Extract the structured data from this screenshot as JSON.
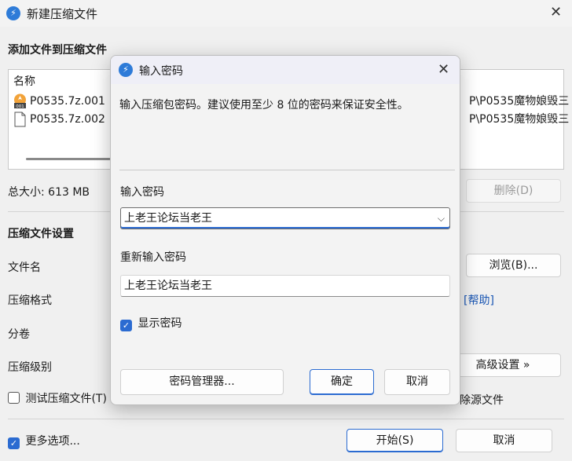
{
  "bg": {
    "title": "新建压缩文件",
    "add_heading": "添加文件到压缩文件",
    "list_header": "名称",
    "files": [
      {
        "name": "P0535.7z.001",
        "path": "P\\P0535魔物娘毁三"
      },
      {
        "name": "P0535.7z.002",
        "path": "P\\P0535魔物娘毁三"
      }
    ],
    "total_size": "总大小: 613 MB",
    "delete_button": "删除(D)",
    "settings_heading": "压缩文件设置",
    "filename_label": "文件名",
    "browse_button": "浏览(B)...",
    "format_label": "压缩格式",
    "help_link": "[帮助]",
    "split_label": "分卷",
    "level_label": "压缩级别",
    "advanced_button": "高级设置 »",
    "test_checkbox": "测试压缩文件(T)",
    "delete_after": "除源文件",
    "more_options": "更多选项...",
    "start_button": "开始(S)",
    "cancel_button": "取消"
  },
  "dialog": {
    "title": "输入密码",
    "instruction": "输入压缩包密码。建议使用至少 8 位的密码来保证安全性。",
    "password_label": "输入密码",
    "password_value": "上老王论坛当老王",
    "reenter_label": "重新输入密码",
    "reenter_value": "上老王论坛当老王",
    "show_password": "显示密码",
    "manager_button": "密码管理器...",
    "ok_button": "确定",
    "cancel_button": "取消"
  },
  "colors": {
    "accent": "#2b6bd1",
    "link": "#1a56b3"
  },
  "icons": [
    "app-icon",
    "close-icon",
    "archive-file-icon",
    "blank-file-icon",
    "chevron-down-icon",
    "check-icon"
  ]
}
